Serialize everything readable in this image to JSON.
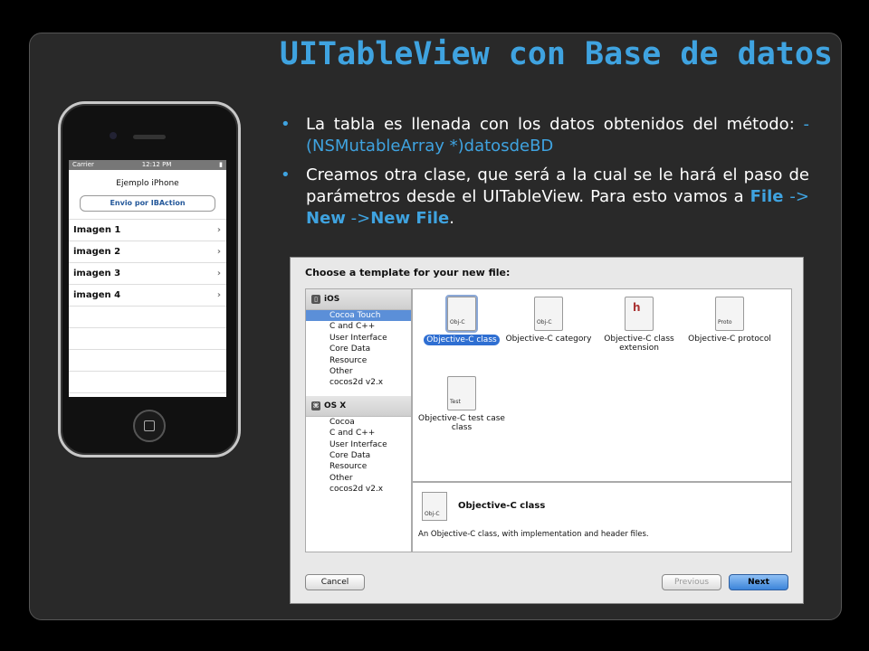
{
  "slide": {
    "title": "UITableView con Base de datos",
    "bullets": [
      {
        "text": "La tabla es llenada con los datos obtenidos del método: ",
        "code": "- (NSMutableArray *)datosdeBD"
      },
      {
        "t1": "Creamos otra clase, que será a la cual se le hará el paso de parámetros desde el UITableView. Para esto vamos a ",
        "file": "File",
        "arrow1": " -> ",
        "new": "New",
        "arrow2": " ->",
        "newfile": "New File",
        "end": "."
      }
    ]
  },
  "phone": {
    "carrier": "Carrier",
    "time": "12:12 PM",
    "app_title": "Ejemplo iPhone",
    "button": "Envio por IBAction",
    "rows": [
      "Imagen 1",
      "imagen 2",
      "imagen 3",
      "imagen 4"
    ]
  },
  "dialog": {
    "heading": "Choose a template for your new file:",
    "ios_section": "iOS",
    "ios_items": [
      "Cocoa Touch",
      "C and C++",
      "User Interface",
      "Core Data",
      "Resource",
      "Other",
      "cocos2d v2.x"
    ],
    "osx_section": "OS X",
    "osx_items": [
      "Cocoa",
      "C and C++",
      "User Interface",
      "Core Data",
      "Resource",
      "Other",
      "cocos2d v2.x"
    ],
    "templates": [
      {
        "label": "Objective-C class",
        "tag": "Obj-C"
      },
      {
        "label": "Objective-C category",
        "tag": "Obj-C"
      },
      {
        "label": "Objective-C class extension",
        "tag": "h"
      },
      {
        "label": "Objective-C protocol",
        "tag": "Proto"
      },
      {
        "label": "Objective-C test case class",
        "tag": "Test"
      }
    ],
    "desc_title": "Objective-C class",
    "desc_text": "An Objective-C class, with implementation and header files.",
    "cancel": "Cancel",
    "previous": "Previous",
    "next": "Next"
  }
}
